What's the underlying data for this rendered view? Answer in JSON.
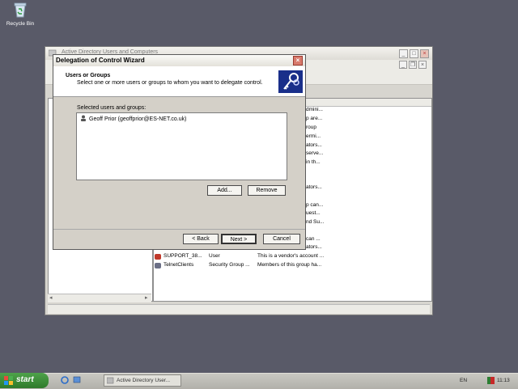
{
  "desktop": {
    "recycle_label": "Recycle Bin"
  },
  "bg_window": {
    "title": "Active Directory Users and Computers",
    "list_fragments": [
      "dmini...",
      "p are...",
      "roup",
      "ermi...",
      "ators...",
      "serve...",
      "in th...",
      "ators...",
      "p can...",
      "uest...",
      "nd Su...",
      "can ...",
      "ators..."
    ],
    "rows": [
      {
        "name": "SUPPORT_38...",
        "type": "User",
        "desc": "This is a vendor's account ..."
      },
      {
        "name": "TelnetClients",
        "type": "Security Group ...",
        "desc": "Members of this group ha..."
      }
    ]
  },
  "dialog": {
    "title": "Delegation of Control Wizard",
    "close_glyph": "×",
    "heading": "Users or Groups",
    "subheading": "Select one or more users or groups to whom you want to delegate control.",
    "list_label": "Selected users and groups:",
    "selected_items": [
      "Geoff Prior (geoffprior@ES-NET.co.uk)"
    ],
    "buttons": {
      "add": "Add...",
      "remove": "Remove",
      "back": "< Back",
      "next": "Next >",
      "cancel": "Cancel"
    }
  },
  "taskbar": {
    "start_label": "start",
    "task_label": "Active Directory User...",
    "lang": "EN",
    "time": "11:13"
  },
  "colors": {
    "desktop": "#595a68",
    "dialog_face": "#d4d0c8",
    "start_green": "#3a8c36"
  }
}
